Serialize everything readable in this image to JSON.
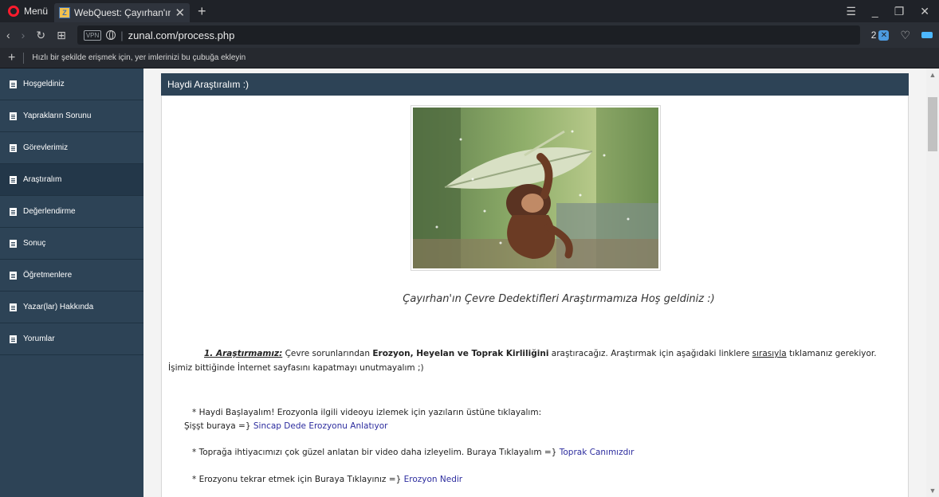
{
  "browser": {
    "menu_label": "Menü",
    "tab_title": "WebQuest: Çayırhan'ın Çe",
    "tab_close": "✕",
    "new_tab": "+",
    "url": "zunal.com/process.php",
    "vpn_label": "VPN",
    "adblock_count": "2",
    "bookmark_hint": "Hızlı bir şekilde erişmek için, yer imlerinizi bu çubuğa ekleyin"
  },
  "sidebar": {
    "items": [
      {
        "label": "Hoşgeldiniz"
      },
      {
        "label": "Yaprakların Sorunu"
      },
      {
        "label": "Görevlerimiz"
      },
      {
        "label": "Araştıralım"
      },
      {
        "label": "Değerlendirme"
      },
      {
        "label": "Sonuç"
      },
      {
        "label": "Öğretmenlere"
      },
      {
        "label": "Yazar(lar) Hakkında"
      },
      {
        "label": "Yorumlar"
      }
    ],
    "active_index": 3
  },
  "content": {
    "header": "Haydi Araştıralım :)",
    "welcome": "Çayırhan'ın Çevre Dedektifleri Araştırmamıza Hoş geldiniz  :)",
    "para": {
      "lead": "1. Araştırmamız:",
      "t1": " Çevre sorunlarından ",
      "bold": "Erozyon,  Heyelan ve Toprak Kirliliğini",
      "t2": " araştıracağız. Araştırmak için aşağıdaki linklere ",
      "underline": "sırasıyla",
      "t3": " tıklamanız gerekiyor. İşimiz bittiğinde İnternet sayfasını kapatmayı unutmayalım ;)"
    },
    "item1_line1": "* Haydi Başlayalım! Erozyonla ilgili videoyu izlemek için yazıların üstüne tıklayalım:",
    "item1_prefix": "Şişşt buraya =} ",
    "item1_link": "Sincap Dede Erozyonu Anlatıyor",
    "item2_prefix": "* Toprağa ihtiyacımızı çok güzel anlatan bir video daha izleyelim. Buraya Tıklayalım =} ",
    "item2_link": "Toprak Canımızdır",
    "item3_prefix": "* Erozyonu tekrar etmek için Buraya Tıklayınız =} ",
    "item3_link": "Erozyon Nedir"
  },
  "colors": {
    "sidebar_bg": "#2d4356",
    "link": "#2c2c9e",
    "opera_red": "#ff1b2d"
  }
}
